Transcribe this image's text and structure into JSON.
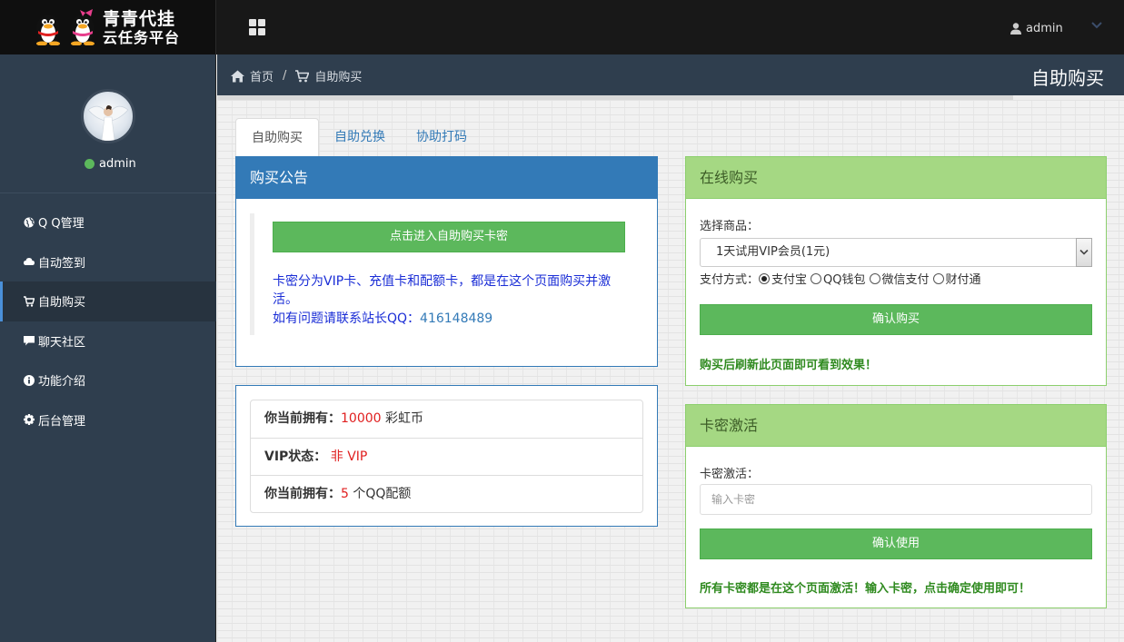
{
  "brand": {
    "title_line1": "青青代挂",
    "title_line2": "云任务平台"
  },
  "header": {
    "username": "admin"
  },
  "sidebar": {
    "user": {
      "name": "admin",
      "status_color": "#5cb85c"
    },
    "items": [
      {
        "label": "Q Q管理",
        "icon": "globe-icon"
      },
      {
        "label": "自动签到",
        "icon": "cloud-icon"
      },
      {
        "label": "自助购买",
        "icon": "cart-icon",
        "active": true
      },
      {
        "label": "聊天社区",
        "icon": "comment-icon"
      },
      {
        "label": "功能介绍",
        "icon": "info-icon"
      },
      {
        "label": "后台管理",
        "icon": "gear-icon"
      }
    ]
  },
  "breadcrumb": {
    "home": "首页",
    "separator": "/",
    "current": "自助购买"
  },
  "page_title": "自助购买",
  "tabs": [
    {
      "label": "自助购买",
      "active": true
    },
    {
      "label": "自助兑换"
    },
    {
      "label": "协助打码"
    }
  ],
  "notice": {
    "title": "购买公告",
    "button": "点击进入自助购买卡密",
    "text1": "卡密分为VIP卡、充值卡和配额卡，都是在这个页面购买并激活。",
    "text2_prefix": "如有问题请联系站长QQ：",
    "qq": "416148489"
  },
  "status": {
    "rows": [
      {
        "label": "你当前拥有：",
        "value": "10000",
        "suffix": " 彩虹币"
      },
      {
        "label": "VIP状态：",
        "value": "非 VIP",
        "suffix": ""
      },
      {
        "label": "你当前拥有：",
        "value": "5",
        "suffix": " 个QQ配额"
      }
    ]
  },
  "buy": {
    "title": "在线购买",
    "product_label": "选择商品：",
    "product_selected": "1天试用VIP会员(1元)",
    "pay_label": "支付方式：",
    "pay_options": [
      "支付宝",
      "QQ钱包",
      "微信支付",
      "财付通"
    ],
    "pay_selected_index": 0,
    "button": "确认购买",
    "note": "购买后刷新此页面即可看到效果！"
  },
  "activate": {
    "title": "卡密激活",
    "label": "卡密激活：",
    "placeholder": "输入卡密",
    "button": "确认使用",
    "note": "所有卡密都是在这个页面激活！输入卡密，点击确定使用即可！"
  },
  "colors": {
    "primary": "#337ab7",
    "success": "#5cb85c",
    "panel_green": "#a5d883",
    "sidebar": "#2f3e4e",
    "topbar": "#181818",
    "highlight_red": "#e02020",
    "notice_blue": "#1a2dd6"
  }
}
